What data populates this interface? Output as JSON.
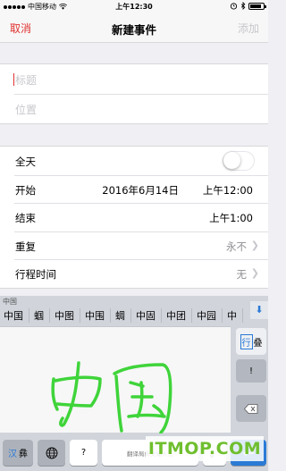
{
  "status_bar": {
    "carrier": "中国移动",
    "time": "上午12:30",
    "battery_level": 0.85
  },
  "nav": {
    "cancel": "取消",
    "title": "新建事件",
    "add": "添加"
  },
  "fields": {
    "title_placeholder": "标题",
    "location_placeholder": "位置"
  },
  "rows": {
    "all_day": {
      "label": "全天",
      "on": false
    },
    "start": {
      "label": "开始",
      "date": "2016年6月14日",
      "time": "上午12:00"
    },
    "end": {
      "label": "结束",
      "time": "上午1:00"
    },
    "repeat": {
      "label": "重复",
      "value": "永不"
    },
    "travel": {
      "label": "行程时间",
      "value": "无"
    }
  },
  "keyboard": {
    "input_preview": "中国",
    "candidates": [
      "中国",
      "蝈",
      "中图",
      "中围",
      "蜩",
      "中固",
      "中团",
      "中园",
      "中"
    ],
    "side_row_active": "行",
    "side_row_other": "叠",
    "excl_key": "!",
    "lang_key_active": "汉",
    "lang_key_other": "彝",
    "question_key": "?",
    "space_hint": "翻译局彝文输入法",
    "period_key": "。",
    "stroke_color": "#3fd43a"
  },
  "watermark": "ITMOP.COM",
  "colors": {
    "accent_red": "#e0322f",
    "keyboard_blue": "#2a7ad6",
    "watermark_green": "#6fbf2e"
  }
}
